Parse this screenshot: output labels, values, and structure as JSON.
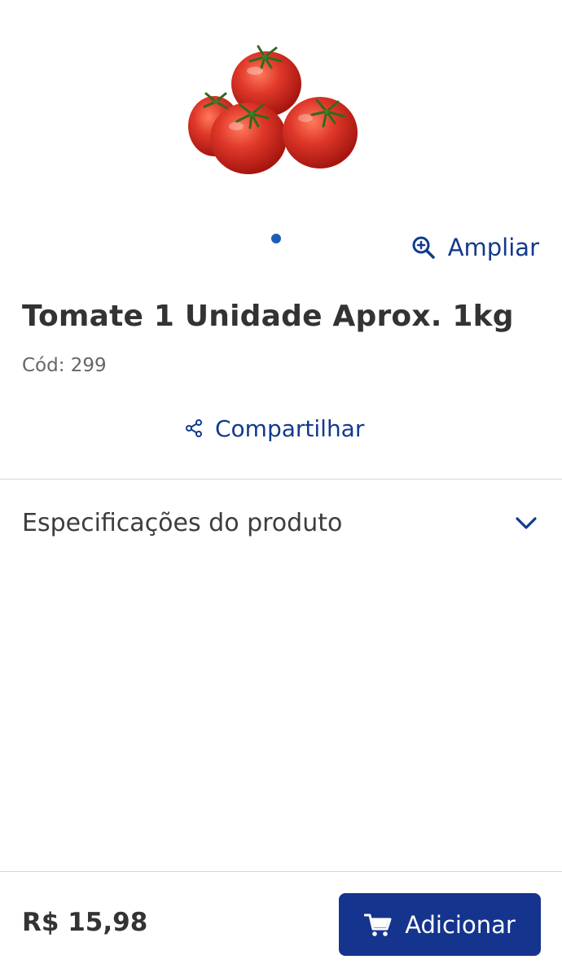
{
  "product": {
    "image_name": "tomato-photo",
    "title": "Tomate 1 Unidade Aprox. 1kg",
    "code": "Cód: 299"
  },
  "gallery": {
    "zoom_label": "Ampliar"
  },
  "share": {
    "label": "Compartilhar"
  },
  "specs": {
    "label": "Especificações do produto"
  },
  "footer": {
    "price": "R$ 15,98",
    "add_label": "Adicionar"
  },
  "colors": {
    "link": "#123a8c",
    "button": "#15348e",
    "dot": "#1f5db4",
    "text": "#333333"
  }
}
